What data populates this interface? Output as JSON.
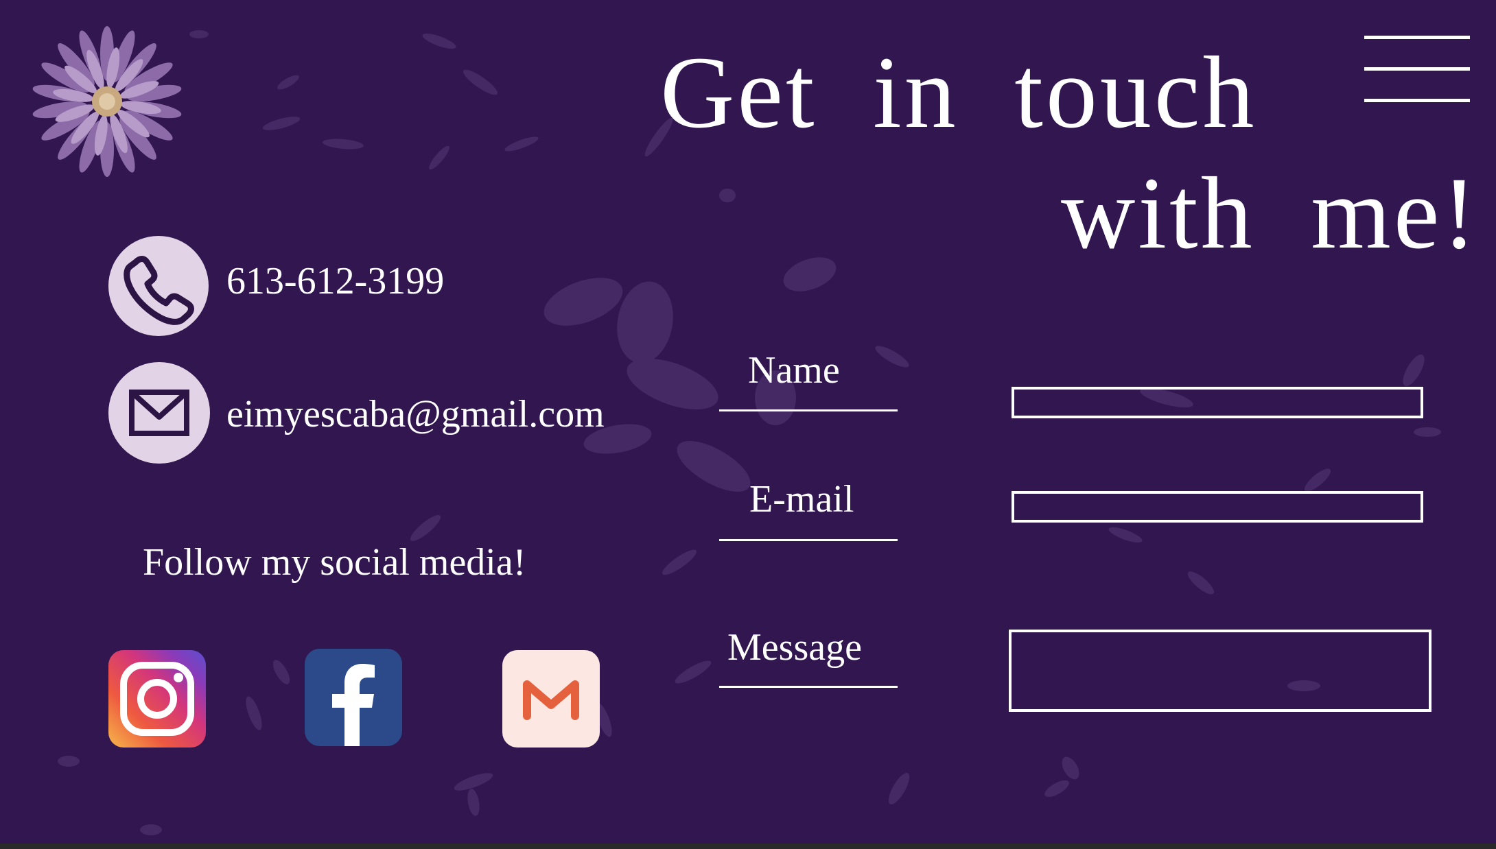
{
  "page": {
    "background_color": "#311650",
    "title_line_1": "Get in touch",
    "title_line_2": "with me!"
  },
  "header": {
    "logo_icon": "purple-flower-icon",
    "menu_icon": "hamburger-menu-icon"
  },
  "contact": {
    "phone_icon": "phone-icon",
    "phone": "613-612-3199",
    "email_icon": "envelope-icon",
    "email": "eimyescaba@gmail.com",
    "icon_background": "#e3d3e6"
  },
  "social": {
    "heading": "Follow my social media!",
    "links": [
      {
        "icon": "instagram-icon"
      },
      {
        "icon": "facebook-icon",
        "color": "#2c4a8a"
      },
      {
        "icon": "gmail-icon",
        "color": "#e5603c"
      }
    ]
  },
  "form": {
    "name_label": "Name",
    "name_value": "",
    "email_label": "E-mail",
    "email_value": "",
    "message_label": "Message",
    "message_value": ""
  }
}
